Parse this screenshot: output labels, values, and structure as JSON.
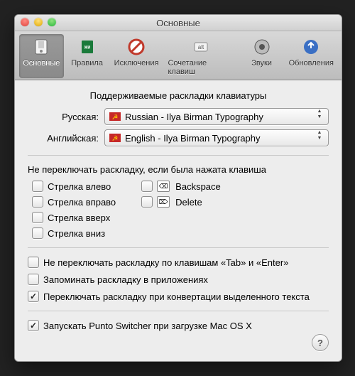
{
  "window": {
    "title": "Основные"
  },
  "toolbar": {
    "items": [
      {
        "label": "Основные",
        "selected": true
      },
      {
        "label": "Правила"
      },
      {
        "label": "Исключения"
      },
      {
        "label": "Сочетание клавиш"
      },
      {
        "label": "Звуки"
      },
      {
        "label": "Обновления"
      }
    ]
  },
  "layouts": {
    "heading": "Поддерживаемые раскладки клавиатуры",
    "russian_label": "Русская:",
    "russian_value": "Russian - Ilya Birman Typography",
    "english_label": "Английская:",
    "english_value": "English - Ilya Birman Typography"
  },
  "skip_keys": {
    "heading": "Не переключать раскладку, если была нажата клавиша",
    "left": "Стрелка влево",
    "right": "Стрелка вправо",
    "up": "Стрелка вверх",
    "down": "Стрелка вниз",
    "backspace": "Backspace",
    "delete": "Delete"
  },
  "options": {
    "tab_enter": "Не переключать раскладку по клавишам «Tab» и «Enter»",
    "remember_per_app": "Запоминать раскладку в приложениях",
    "convert_on_selection": "Переключать раскладку при конвертации выделенного текста",
    "launch_on_boot": "Запускать Punto Switcher при загрузке Mac OS X"
  },
  "checks": {
    "left": false,
    "right": false,
    "up": false,
    "down": false,
    "backspace": false,
    "delete": false,
    "tab_enter": false,
    "remember_per_app": false,
    "convert_on_selection": true,
    "launch_on_boot": true
  },
  "help": "?"
}
